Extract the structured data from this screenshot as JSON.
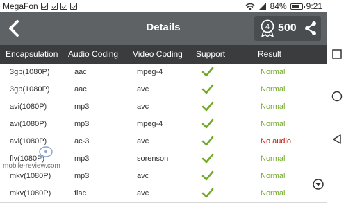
{
  "statusbar": {
    "carrier": "MegaFon",
    "battery": "84%",
    "time": "9:21"
  },
  "header": {
    "title": "Details",
    "badge_number": "4",
    "score": "500"
  },
  "table": {
    "headers": [
      "Encapsulation",
      "Audio Coding",
      "Video Coding",
      "Support",
      "Result"
    ],
    "rows": [
      {
        "enc": "3gp(1080P)",
        "audio": "aac",
        "video": "mpeg-4",
        "result": "Normal",
        "status": "ok"
      },
      {
        "enc": "3gp(1080P)",
        "audio": "aac",
        "video": "avc",
        "result": "Normal",
        "status": "ok"
      },
      {
        "enc": "avi(1080P)",
        "audio": "mp3",
        "video": "avc",
        "result": "Normal",
        "status": "ok"
      },
      {
        "enc": "avi(1080P)",
        "audio": "mp3",
        "video": "mpeg-4",
        "result": "Normal",
        "status": "ok"
      },
      {
        "enc": "avi(1080P)",
        "audio": "ac-3",
        "video": "avc",
        "result": "No audio",
        "status": "bad"
      },
      {
        "enc": "flv(1080P)",
        "audio": "mp3",
        "video": "sorenson",
        "result": "Normal",
        "status": "ok"
      },
      {
        "enc": "mkv(1080P)",
        "audio": "mp3",
        "video": "avc",
        "result": "Normal",
        "status": "ok"
      },
      {
        "enc": "mkv(1080P)",
        "audio": "flac",
        "video": "avc",
        "result": "Normal",
        "status": "ok"
      }
    ]
  },
  "watermark": "mobile-review.com",
  "colors": {
    "topbar": "#5f6264",
    "header_row": "#3a3c3d",
    "ok": "#73a92b",
    "bad": "#cc1a10"
  }
}
